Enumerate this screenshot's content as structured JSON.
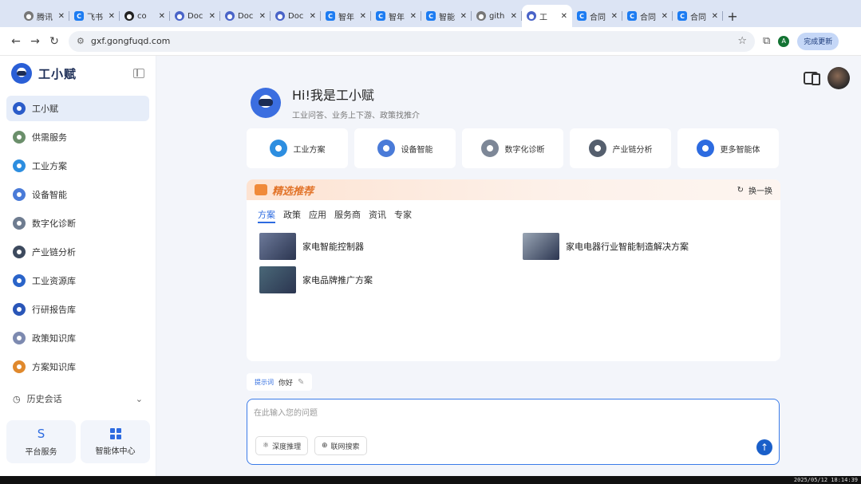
{
  "browser": {
    "tabs": [
      {
        "label": "腾讯",
        "icon": "globe-icon",
        "active": false
      },
      {
        "label": "飞书",
        "icon": "c-icon",
        "active": false
      },
      {
        "label": "co",
        "icon": "github-icon",
        "active": false
      },
      {
        "label": "Doc",
        "icon": "doc-icon",
        "active": false
      },
      {
        "label": "Doc",
        "icon": "doc-icon",
        "active": false
      },
      {
        "label": "Doc",
        "icon": "doc-icon",
        "active": false
      },
      {
        "label": "智年",
        "icon": "c-icon",
        "active": false
      },
      {
        "label": "智年",
        "icon": "c-icon",
        "active": false
      },
      {
        "label": "智能",
        "icon": "c-icon",
        "active": false
      },
      {
        "label": "gith",
        "icon": "globe-icon",
        "active": false
      },
      {
        "label": "工",
        "icon": "robot-icon",
        "active": true
      },
      {
        "label": "合同",
        "icon": "c-icon",
        "active": false
      },
      {
        "label": "合同",
        "icon": "c-icon",
        "active": false
      },
      {
        "label": "合同",
        "icon": "c-icon",
        "active": false
      }
    ],
    "url": "gxf.gongfuqd.com",
    "profile_initial": "A",
    "update_label": "完成更新"
  },
  "sidebar": {
    "brand": "工小赋",
    "items": [
      {
        "label": "工小赋",
        "icon": "robot-icon",
        "color": "#2b5cc9",
        "active": true
      },
      {
        "label": "供需服务",
        "icon": "supply-icon",
        "color": "#6b8f6b",
        "active": false
      },
      {
        "label": "工业方案",
        "icon": "solution-icon",
        "color": "#2d8ee0",
        "active": false
      },
      {
        "label": "设备智能",
        "icon": "device-icon",
        "color": "#4a7bd8",
        "active": false
      },
      {
        "label": "数字化诊断",
        "icon": "diagnosis-icon",
        "color": "#6e7c90",
        "active": false
      },
      {
        "label": "产业链分析",
        "icon": "chain-icon",
        "color": "#3d4a5e",
        "active": false
      },
      {
        "label": "工业资源库",
        "icon": "resource-icon",
        "color": "#2a64c9",
        "active": false
      },
      {
        "label": "行研报告库",
        "icon": "report-icon",
        "color": "#2a56b8",
        "active": false
      },
      {
        "label": "政策知识库",
        "icon": "policy-icon",
        "color": "#7d8ab0",
        "active": false
      },
      {
        "label": "方案知识库",
        "icon": "knowledge-icon",
        "color": "#e0892d",
        "active": false
      }
    ],
    "history_label": "历史会话",
    "bottom": [
      {
        "label": "平台服务",
        "icon": "platform-icon"
      },
      {
        "label": "智能体中心",
        "icon": "grid-icon"
      }
    ]
  },
  "hero": {
    "title": "Hi!我是工小赋",
    "subtitle": "工业问答、业务上下游、政策找推介"
  },
  "features": [
    {
      "label": "工业方案",
      "icon": "solution-icon",
      "color": "#2d8ee0"
    },
    {
      "label": "设备智能",
      "icon": "device-icon",
      "color": "#4a7bd8"
    },
    {
      "label": "数字化诊断",
      "icon": "diagnosis-icon",
      "color": "#7d8797"
    },
    {
      "label": "产业链分析",
      "icon": "chain-icon",
      "color": "#555f6e"
    },
    {
      "label": "更多智能体",
      "icon": "more-icon",
      "color": "#2d6be0"
    }
  ],
  "recommend": {
    "title": "精选推荐",
    "refresh_label": "换一换",
    "tabs": [
      "方案",
      "政策",
      "应用",
      "服务商",
      "资讯",
      "专家"
    ],
    "active_tab": 0,
    "items": [
      {
        "title": "家电智能控制器",
        "thumb_color": "#6d7a9a"
      },
      {
        "title": "家电电器行业智能制造解决方案",
        "thumb_color": "#9aa6b5"
      },
      {
        "title": "家电品牌推广方案",
        "thumb_color": "#4a6878"
      }
    ]
  },
  "prompt_chip": {
    "tag": "提示词",
    "text": "你好"
  },
  "composer": {
    "placeholder": "在此输入您的问题",
    "deep_think_label": "深度推理",
    "web_search_label": "联网搜索"
  },
  "taskbar": {
    "clock": "2025/05/12 18:14:39"
  }
}
